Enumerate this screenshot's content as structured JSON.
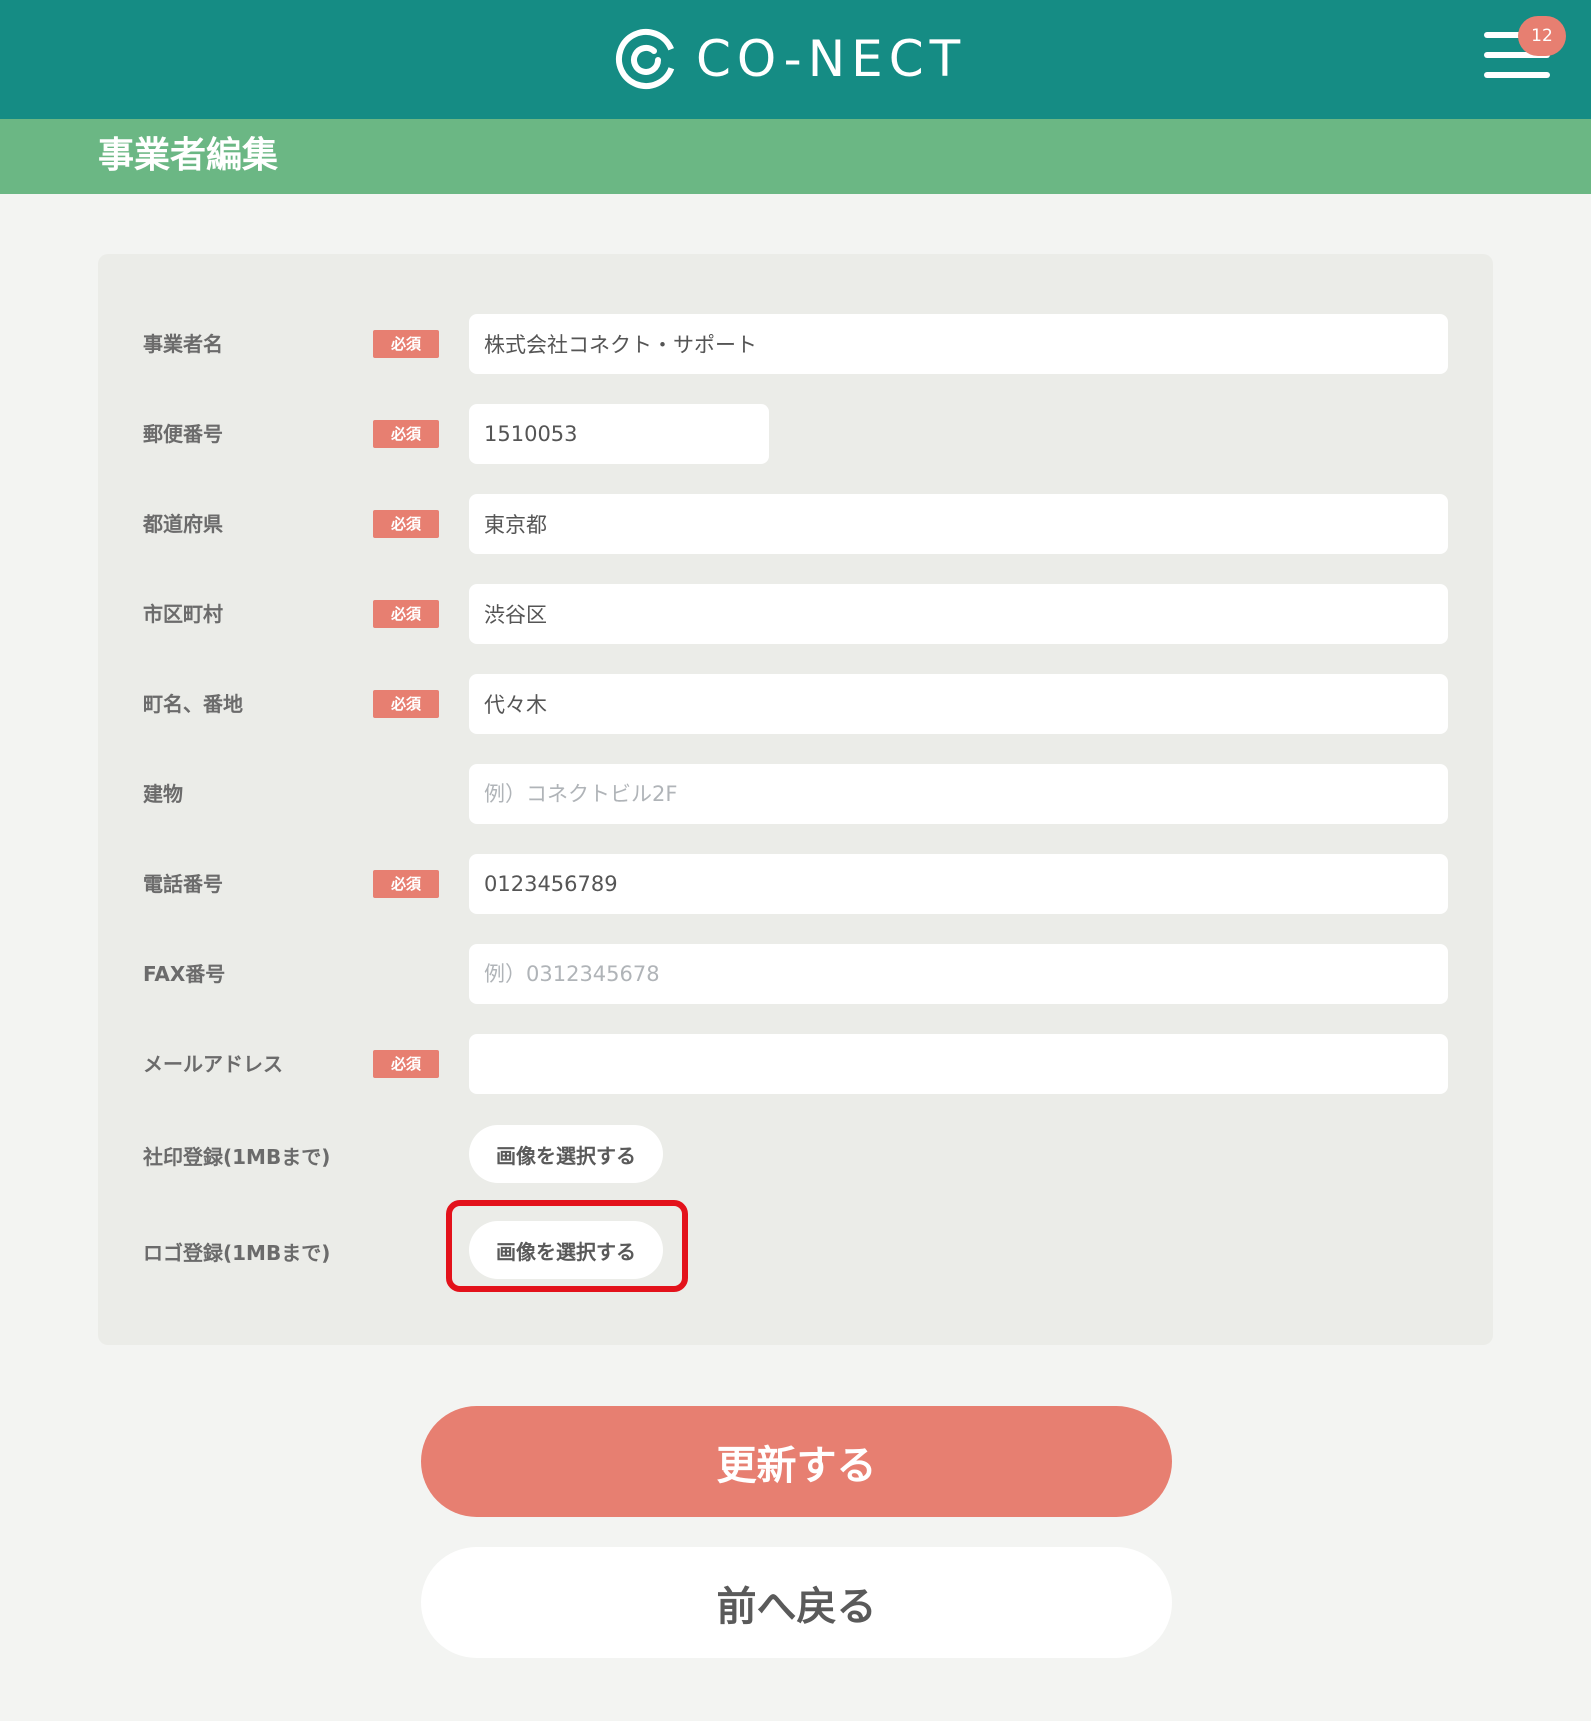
{
  "header": {
    "brand": "CO-NECT",
    "notification_count": "12"
  },
  "page": {
    "title": "事業者編集"
  },
  "required_badge": "必須",
  "form": {
    "fields": [
      {
        "label": "事業者名",
        "required": true,
        "value": "株式会社コネクト・サポート",
        "placeholder": ""
      },
      {
        "label": "郵便番号",
        "required": true,
        "value": "1510053",
        "placeholder": ""
      },
      {
        "label": "都道府県",
        "required": true,
        "value": "東京都",
        "placeholder": ""
      },
      {
        "label": "市区町村",
        "required": true,
        "value": "渋谷区",
        "placeholder": ""
      },
      {
        "label": "町名、番地",
        "required": true,
        "value": "代々木",
        "placeholder": ""
      },
      {
        "label": "建物",
        "required": false,
        "value": "",
        "placeholder": "例）コネクトビル2F"
      },
      {
        "label": "電話番号",
        "required": true,
        "value": "0123456789",
        "placeholder": ""
      },
      {
        "label": "FAX番号",
        "required": false,
        "value": "",
        "placeholder": "例）0312345678"
      },
      {
        "label": "メールアドレス",
        "required": true,
        "value": "",
        "placeholder": ""
      }
    ],
    "uploads": [
      {
        "label": "社印登録(1MBまで)",
        "button": "画像を選択する"
      },
      {
        "label": "ロゴ登録(1MBまで)",
        "button": "画像を選択する"
      }
    ]
  },
  "actions": {
    "update": "更新する",
    "back": "前へ戻る"
  },
  "colors": {
    "header": "#158c84",
    "title_bar": "#6bb784",
    "accent": "#e77f71",
    "highlight": "#e3121b"
  }
}
